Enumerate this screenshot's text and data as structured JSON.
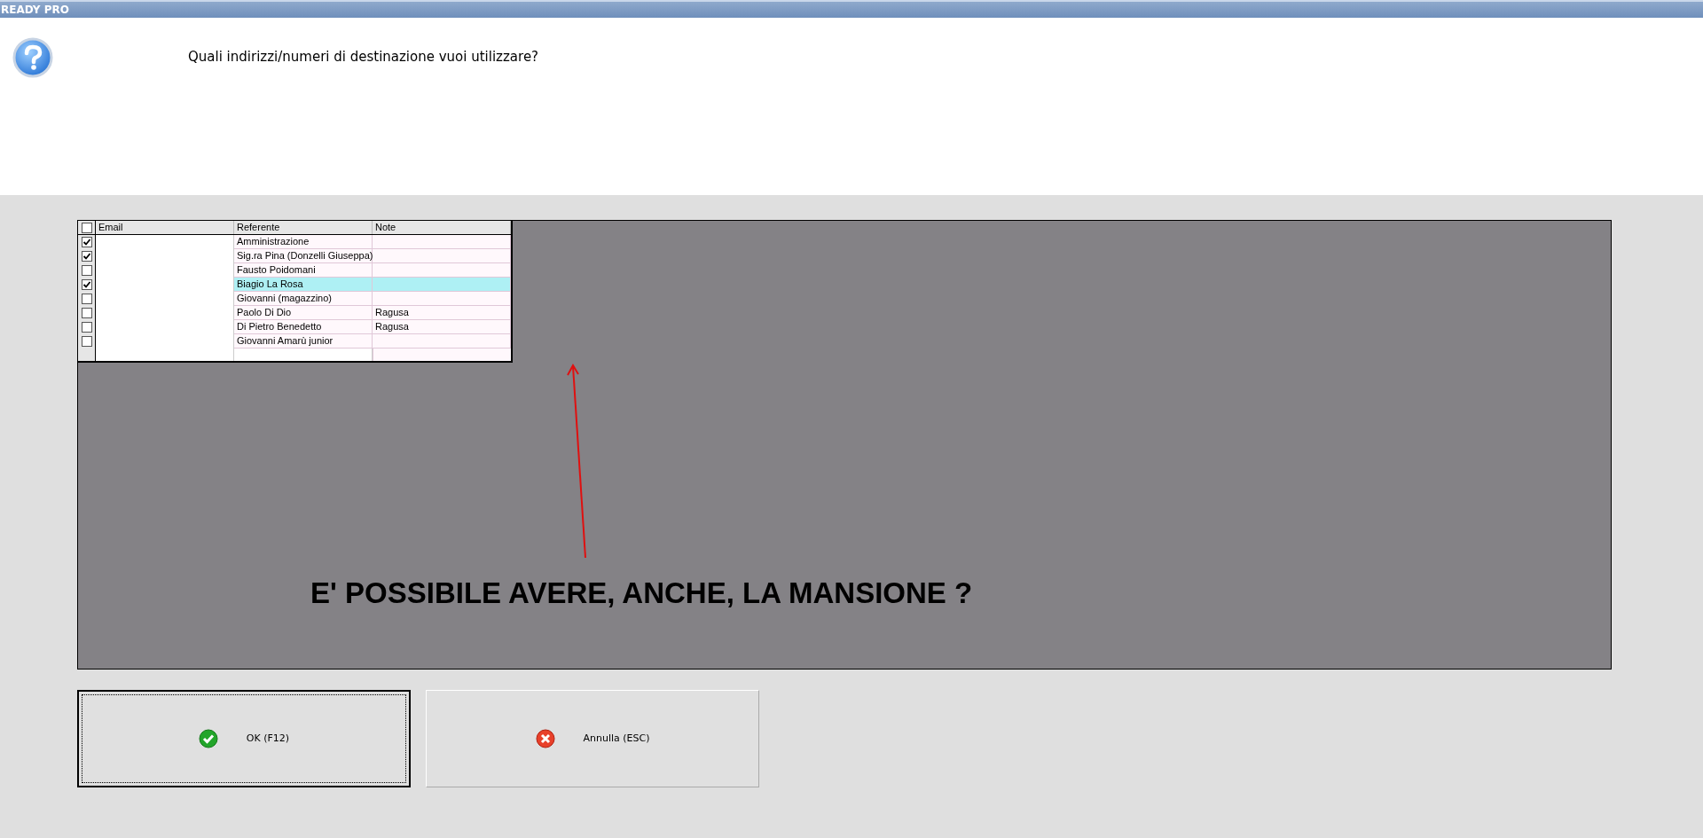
{
  "window": {
    "title": "READY PRO"
  },
  "prompt": {
    "question": "Quali indirizzi/numeri di destinazione vuoi utilizzare?"
  },
  "table": {
    "header_checked": false,
    "columns": [
      "Email",
      "Referente",
      "Note"
    ],
    "rows": [
      {
        "checked": true,
        "selected": false,
        "email": "",
        "referente": "Amministrazione",
        "note": ""
      },
      {
        "checked": true,
        "selected": false,
        "email": "",
        "referente": "Sig.ra Pina (Donzelli Giuseppa)",
        "note": ""
      },
      {
        "checked": false,
        "selected": false,
        "email": "",
        "referente": "Fausto Poidomani",
        "note": ""
      },
      {
        "checked": true,
        "selected": true,
        "email": "",
        "referente": "Biagio La Rosa",
        "note": ""
      },
      {
        "checked": false,
        "selected": false,
        "email": "",
        "referente": "Giovanni (magazzino)",
        "note": ""
      },
      {
        "checked": false,
        "selected": false,
        "email": "",
        "referente": "Paolo Di Dio",
        "note": "Ragusa"
      },
      {
        "checked": false,
        "selected": false,
        "email": "",
        "referente": "Di Pietro Benedetto",
        "note": "Ragusa"
      },
      {
        "checked": false,
        "selected": false,
        "email": "",
        "referente": "Giovanni Amarù junior",
        "note": ""
      }
    ]
  },
  "annotation": {
    "text": "E' POSSIBILE AVERE, ANCHE, LA MANSIONE ?"
  },
  "buttons": [
    {
      "kind": "ok",
      "label": "OK (F12)",
      "focused": true
    },
    {
      "kind": "cancel",
      "label": "Annulla (ESC)",
      "focused": false
    }
  ]
}
